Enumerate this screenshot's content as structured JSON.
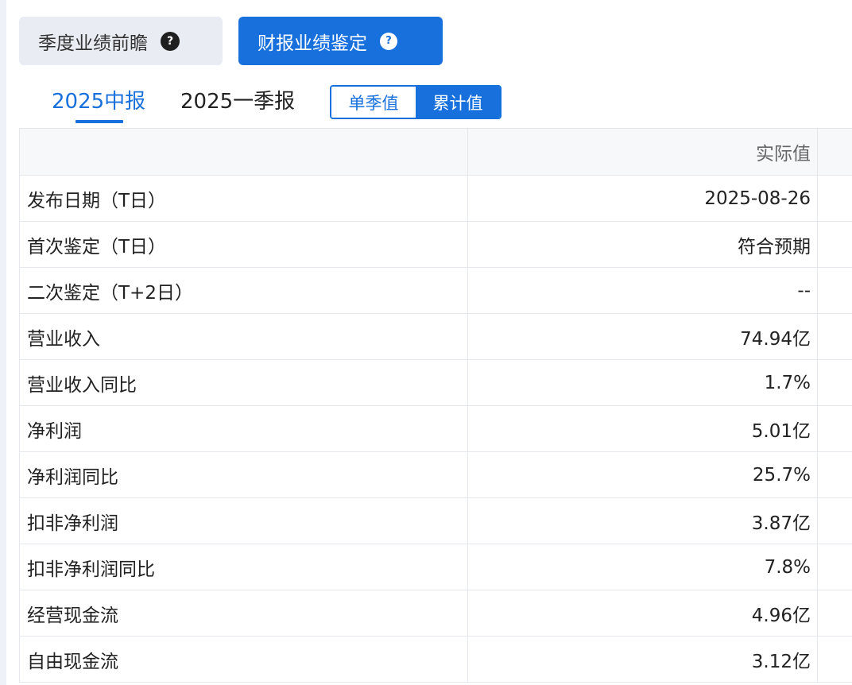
{
  "top_buttons": {
    "forecast_label": "季度业绩前瞻",
    "appraisal_label": "财报业绩鉴定",
    "help_glyph": "?"
  },
  "period_tabs": [
    {
      "label": "2025中报",
      "active": true
    },
    {
      "label": "2025一季报",
      "active": false
    }
  ],
  "value_mode": {
    "options": [
      "单季值",
      "累计值"
    ],
    "selected": "累计值"
  },
  "table": {
    "header": {
      "label": "",
      "value": "实际值"
    },
    "rows": [
      {
        "label": "发布日期（T日）",
        "value": "2025-08-26"
      },
      {
        "label": "首次鉴定（T日）",
        "value": "符合预期"
      },
      {
        "label": "二次鉴定（T+2日）",
        "value": "--"
      },
      {
        "label": "营业收入",
        "value": "74.94亿"
      },
      {
        "label": "营业收入同比",
        "value": "1.7%"
      },
      {
        "label": "净利润",
        "value": "5.01亿"
      },
      {
        "label": "净利润同比",
        "value": "25.7%"
      },
      {
        "label": "扣非净利润",
        "value": "3.87亿"
      },
      {
        "label": "扣非净利润同比",
        "value": "7.8%"
      },
      {
        "label": "经营现金流",
        "value": "4.96亿"
      },
      {
        "label": "自由现金流",
        "value": "3.12亿"
      }
    ]
  },
  "colors": {
    "accent": "#1770dc",
    "inactive_button_bg": "#e9ecf2",
    "border": "#e4e7ec",
    "header_bg": "#f7f8fa"
  },
  "icons": {
    "forecast_help": "help-icon",
    "appraisal_help": "help-icon"
  }
}
